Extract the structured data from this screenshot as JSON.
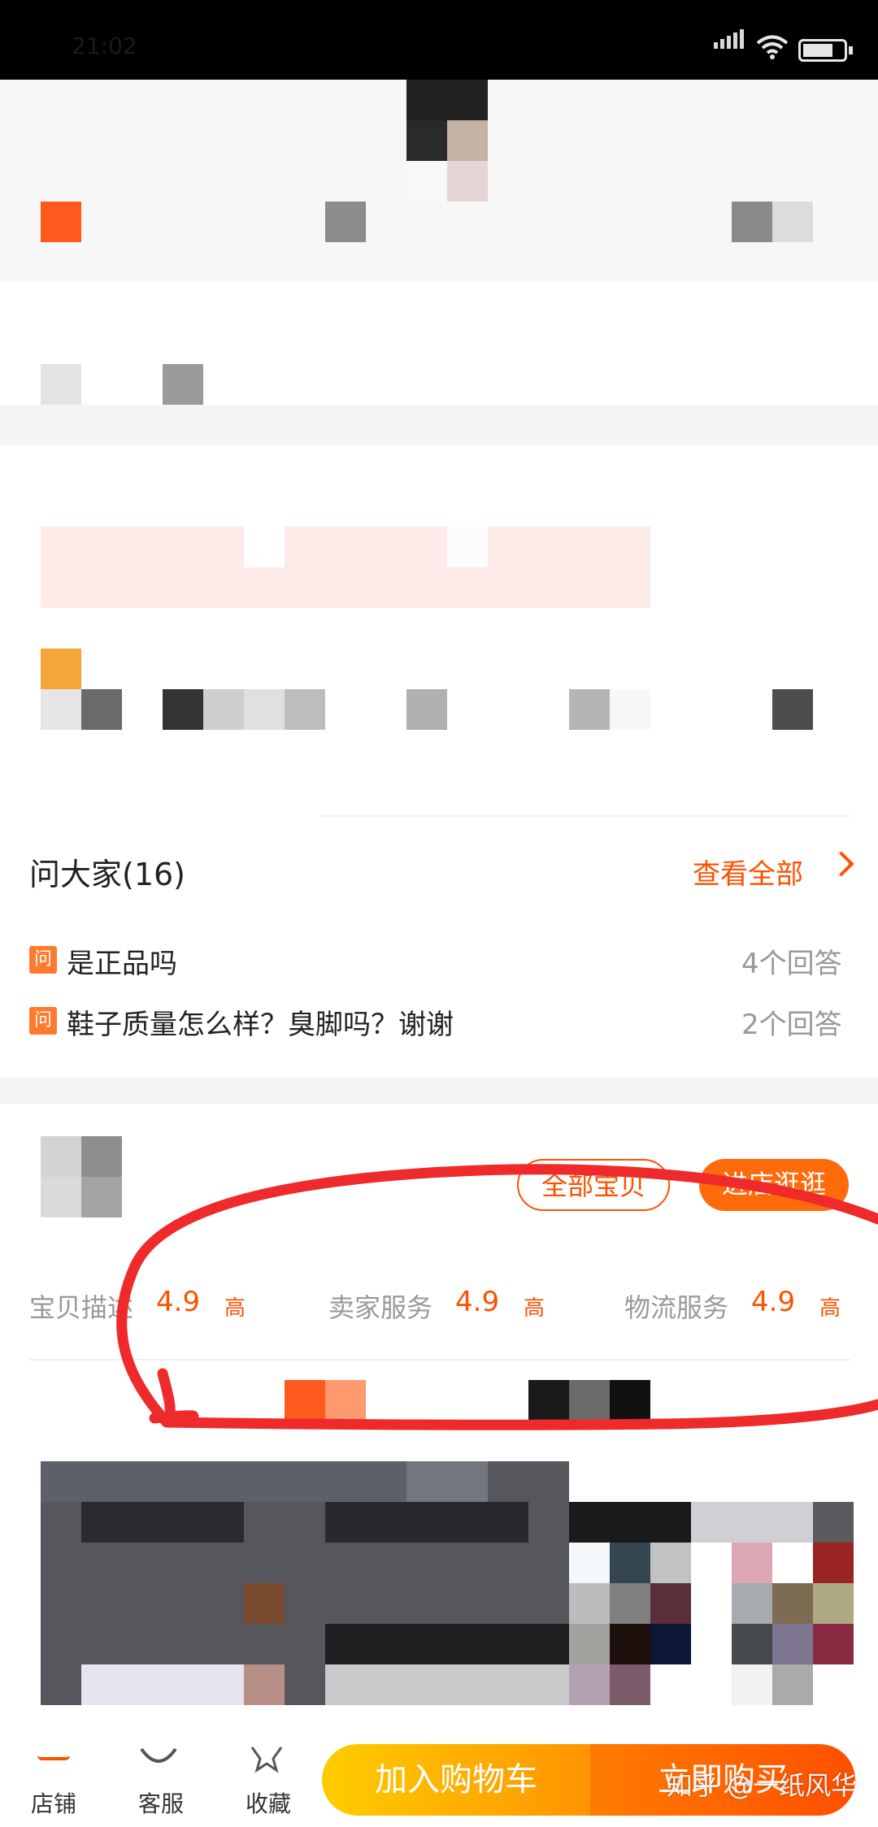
{
  "status_bar": {
    "time": "21:02"
  },
  "ask": {
    "title": "问大家(16)",
    "view_all": "查看全部",
    "badge": "问",
    "questions": [
      {
        "text": "是正品吗",
        "answers": "4个回答"
      },
      {
        "text": "鞋子质量怎么样？臭脚吗？谢谢",
        "answers": "2个回答"
      }
    ]
  },
  "store": {
    "all_items": "全部宝贝",
    "visit_store": "进店逛逛",
    "scores": [
      {
        "label": "宝贝描述",
        "value": "4.9",
        "level": "高"
      },
      {
        "label": "卖家服务",
        "value": "4.9",
        "level": "高"
      },
      {
        "label": "物流服务",
        "value": "4.9",
        "level": "高"
      }
    ]
  },
  "bottom_bar": {
    "shop": "店铺",
    "service": "客服",
    "favorite": "收藏",
    "add_to_cart": "加入购物车",
    "buy_now": "立即购买"
  },
  "watermark": "知乎 @一纸风华",
  "colors": {
    "accent": "#ff5000",
    "annotation_red": "#ee2a2a",
    "cart_gradient": [
      "#ffcc00",
      "#ff9402"
    ],
    "buy_gradient": [
      "#ff7c00",
      "#ff4f00"
    ]
  },
  "icons": [
    "chevron-right-icon",
    "shop-icon",
    "service-icon",
    "star-icon",
    "wifi-icon",
    "battery-icon",
    "signal-icon"
  ]
}
